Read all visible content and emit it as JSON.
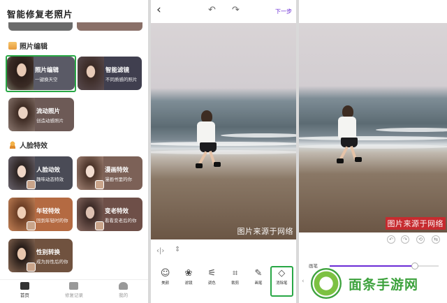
{
  "home": {
    "title": "智能修复老照片",
    "sections": {
      "photo_edit": "照片编辑",
      "face_effects": "人脸特效"
    },
    "cards": {
      "photo_edit": {
        "title": "照片编辑",
        "subtitle": "一键换天空"
      },
      "smart_filter": {
        "title": "智能滤镜",
        "subtitle": "不同质感的照片"
      },
      "flow_photo": {
        "title": "流动照片",
        "subtitle": "创造动感照片"
      },
      "face_animation": {
        "title": "人脸动效",
        "subtitle": "趣味动态特效"
      },
      "comic_effect": {
        "title": "漫画特效",
        "subtitle": "漫画书里的你"
      },
      "younger": {
        "title": "年轻特效",
        "subtitle": "回到年轻时的你"
      },
      "older": {
        "title": "变老特效",
        "subtitle": "看看变老后的你"
      },
      "gender_swap": {
        "title": "性别转换",
        "subtitle": "成为异性后的你"
      }
    },
    "tabs": [
      {
        "label": "首页",
        "active": true
      },
      {
        "label": "修复记录",
        "active": false
      },
      {
        "label": "我的",
        "active": false
      }
    ]
  },
  "editor": {
    "next_label": "下一步",
    "watermark": "图片来源于网络",
    "tools": [
      {
        "label": "美颜",
        "icon": "face-icon"
      },
      {
        "label": "滤镜",
        "icon": "filter-icon"
      },
      {
        "label": "调色",
        "icon": "adjust-icon"
      },
      {
        "label": "裁剪",
        "icon": "crop-icon"
      },
      {
        "label": "画笔",
        "icon": "pen-icon"
      },
      {
        "label": "消除笔",
        "icon": "eraser-icon"
      }
    ]
  },
  "eraser": {
    "watermark": "图片来源于网络",
    "brush_label": "画笔",
    "brush_level": 0.78
  },
  "logo": {
    "text": "面条手游网"
  },
  "colors": {
    "accent": "#6a2bd6",
    "selection": "#28a745",
    "brand": "#3da23d"
  }
}
